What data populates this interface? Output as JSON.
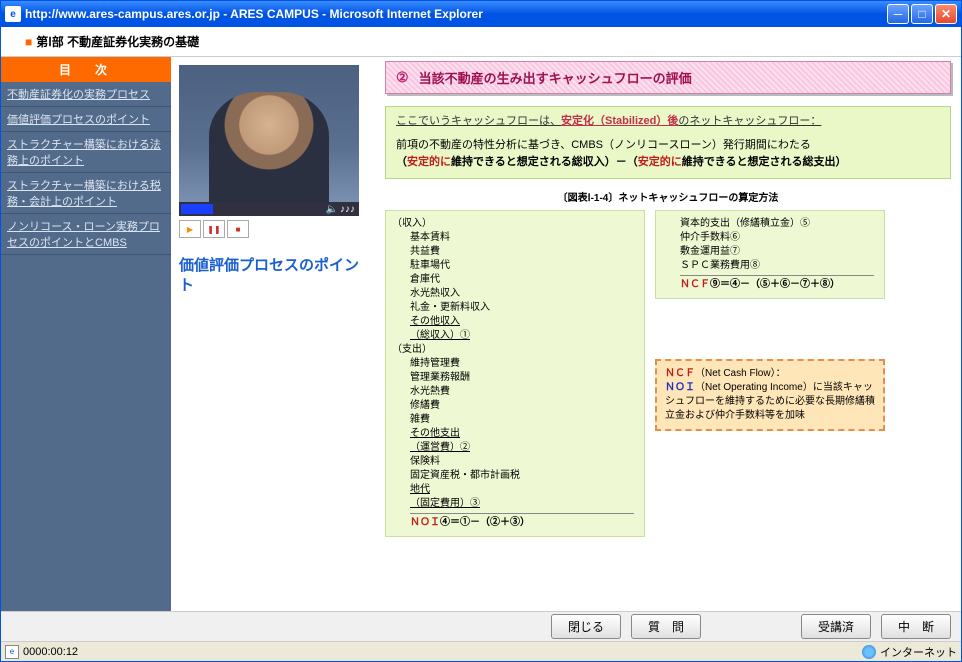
{
  "window": {
    "title": "http://www.ares-campus.ares.or.jp - ARES CAMPUS - Microsoft Internet Explorer"
  },
  "header": {
    "title": "第Ⅰ部 不動産証券化実務の基礎"
  },
  "sidebar": {
    "header": "目　次",
    "items": [
      "不動産証券化の実務プロセス",
      "価値評価プロセスのポイント",
      "ストラクチャー構築における法務上のポイント",
      "ストラクチャー構築における税務・会計上のポイント",
      "ノンリコース・ローン実務プロセスのポイントとCMBS"
    ]
  },
  "video": {
    "title": "価値評価プロセスのポイント",
    "vol_label": "♪♪♪"
  },
  "section": {
    "num": "②",
    "title": "当該不動産の生み出すキャッシュフローの評価"
  },
  "note": {
    "line1_pre": "ここでいうキャッシュフローは、",
    "line1_hl": "安定化（Stabilized）後",
    "line1_post": "のネットキャッシュフロー：",
    "line2": "前項の不動産の特性分析に基づき、CMBS（ノンリコースローン）発行期間にわたる",
    "line3_open": "（",
    "line3_a": "安定的に",
    "line3_b": "維持できると想定される総収入）－（",
    "line3_c": "安定的に",
    "line3_d": "維持できると想定される総支出）"
  },
  "diagram": {
    "caption": "〔図表Ⅰ-1-4〕ネットキャッシュフローの算定方法",
    "left": {
      "income_label": "（収入）",
      "income_items": [
        "基本賃料",
        "共益費",
        "駐車場代",
        "倉庫代",
        "水光熱収入",
        "礼金・更新料収入"
      ],
      "income_sub1": "その他収入",
      "income_sub2": "（総収入）①",
      "expense_label": "（支出）",
      "expense_items": [
        "維持管理費",
        "管理業務報酬",
        "水光熱費",
        "修繕費",
        "雑費"
      ],
      "expense_sub1": "その他支出",
      "expense_sub2": "（運営費）②",
      "expense_items2": [
        "保険料",
        "固定資産税・都市計画税"
      ],
      "expense_sub3": "地代",
      "expense_sub4": "（固定費用）③",
      "noi_label": "ＮＯＩ",
      "noi_formula": "④＝①－（②＋③）"
    },
    "right": {
      "items": [
        "資本的支出（修繕積立金）⑤",
        "仲介手数料⑥",
        "敷金運用益⑦",
        "ＳＰＣ業務費用⑧"
      ],
      "ncf_label": "ＮＣＦ",
      "ncf_formula": "⑨＝④－（⑤＋⑥－⑦＋⑧）"
    },
    "def": {
      "ncf_label": "ＮＣＦ",
      "ncf_text": "（Net Cash Flow）：",
      "noi_label": "ＮＯＩ",
      "noi_text": "（Net Operating Income）に当該キャッシュフローを維持するために必要な長期修繕積立金および仲介手数料等を加味"
    }
  },
  "footer": {
    "close": "閉じる",
    "question": "質　問",
    "done": "受講済",
    "suspend": "中　断"
  },
  "status": {
    "time": "0000:00:12",
    "zone": "インターネット"
  }
}
